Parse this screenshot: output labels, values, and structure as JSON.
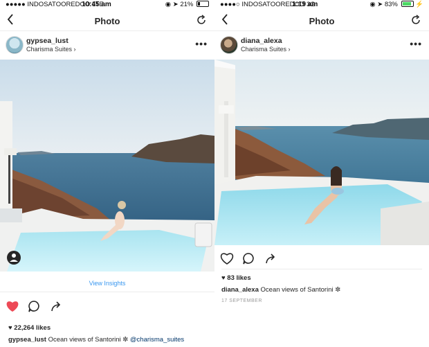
{
  "left": {
    "status": {
      "carrier": "INDOSATOOREDOO",
      "network": "LTE",
      "time": "10:45 am",
      "battery": "21%",
      "battery_level": 0.21
    },
    "nav": {
      "title": "Photo"
    },
    "post": {
      "username": "gypsea_lust",
      "location": "Charisma Suites",
      "insights": "View Insights",
      "likes": "22,264 likes",
      "caption_user": "gypsea_lust",
      "caption_text": "Ocean views of Santorini ✼",
      "caption_mention": "@charisma_suites",
      "liked": true
    }
  },
  "right": {
    "status": {
      "carrier": "INDOSATOOREDOO",
      "network": "3G",
      "time": "1:19 am",
      "battery": "83%",
      "battery_level": 0.83
    },
    "nav": {
      "title": "Photo"
    },
    "post": {
      "username": "diana_alexa",
      "location": "Charisma Suites",
      "likes": "83 likes",
      "caption_user": "diana_alexa",
      "caption_text": "Ocean views of Santorini ✼",
      "date": "17 SEPTEMBER",
      "liked": false
    }
  },
  "colors": {
    "like_red": "#ed4956",
    "link_blue": "#3897f0",
    "battery_green": "#4cd964"
  }
}
